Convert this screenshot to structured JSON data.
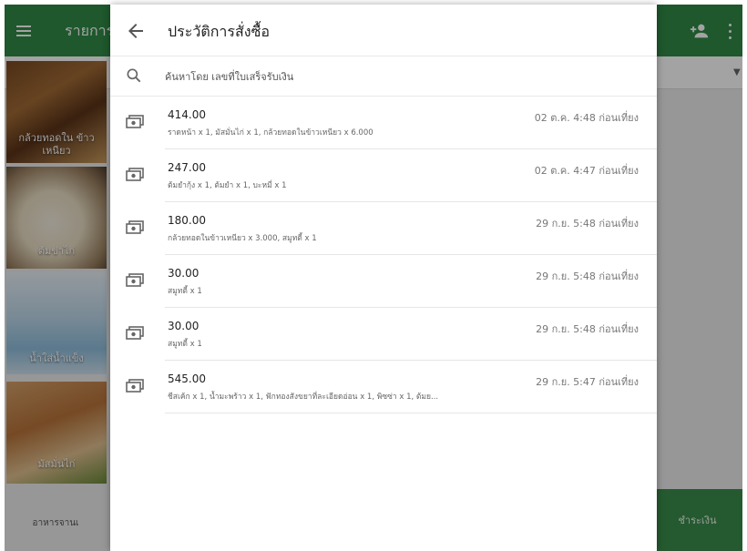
{
  "background_app": {
    "title": "รายการ",
    "menu_tiles": [
      {
        "label": "กล้วยทอดใน ข้าวเหนียว"
      },
      {
        "label": "ต้มข่าไก่"
      },
      {
        "label": "น้ำใส่น้ำแข็ง"
      },
      {
        "label": "มัสมั่นไก่"
      }
    ],
    "bottom_label": "อาหารจานเ",
    "pay_label": "ชำระเงิน",
    "colors": {
      "app_bar": "#2f8a45",
      "pay_button": "#3a8e4b"
    }
  },
  "drawer": {
    "title": "ประวัติการสั่งซื้อ",
    "back_icon": "arrow-back-icon",
    "search": {
      "placeholder": "ค้นหาโดย เลขที่ใบเสร็จรับเงิน",
      "value": ""
    },
    "orders": [
      {
        "amount": "414.00",
        "items": "ราดหน้า x 1, มัสมั่นไก่ x 1, กล้วยทอดในข้าวเหนียว x 6.000",
        "time": "02 ต.ค. 4:48 ก่อนเที่ยง"
      },
      {
        "amount": "247.00",
        "items": "ต้มยำกุ้ง x 1, ต้มยำ x 1, บะหมี่ x 1",
        "time": "02 ต.ค. 4:47 ก่อนเที่ยง"
      },
      {
        "amount": "180.00",
        "items": "กล้วยทอดในข้าวเหนียว x 3.000, สมูทตี้ x 1",
        "time": "29 ก.ย. 5:48 ก่อนเที่ยง"
      },
      {
        "amount": "30.00",
        "items": "สมูทตี้ x 1",
        "time": "29 ก.ย. 5:48 ก่อนเที่ยง"
      },
      {
        "amount": "30.00",
        "items": "สมูทตี้ x 1",
        "time": "29 ก.ย. 5:48 ก่อนเที่ยง"
      },
      {
        "amount": "545.00",
        "items": "ชีสเค้ก x 1, น้ำมะพร้าว x 1, ฟักทองสังขยาที่ละเอียดอ่อน x 1, พิซซ่า x 1, ต้มย...",
        "time": "29 ก.ย. 5:47 ก่อนเที่ยง"
      }
    ]
  }
}
